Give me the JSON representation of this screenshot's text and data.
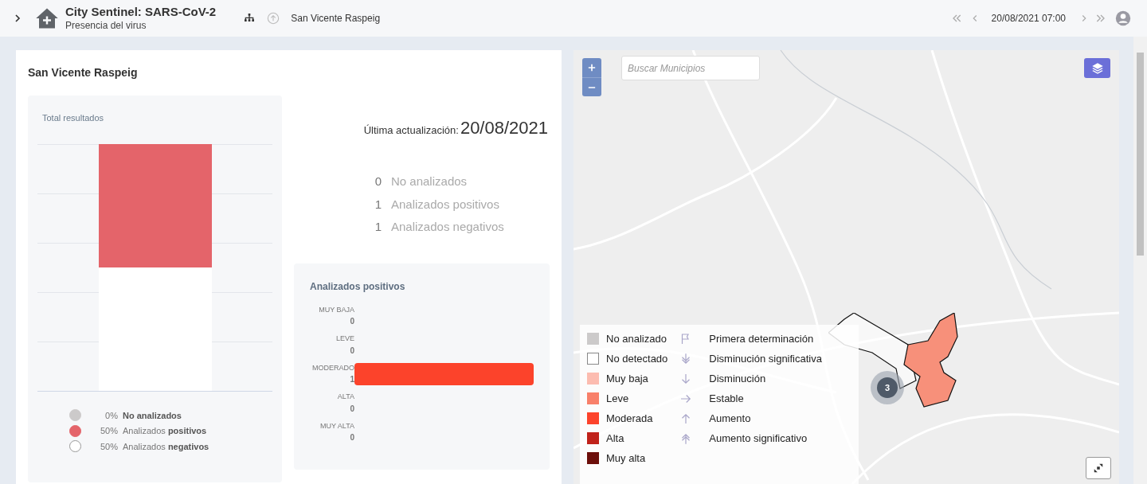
{
  "header": {
    "title": "City Sentinel: SARS-CoV-2",
    "subtitle": "Presencia del virus",
    "breadcrumb": "San Vicente Raspeig",
    "datetime": "20/08/2021 07:00"
  },
  "panel": {
    "title": "San Vicente Raspeig",
    "total": {
      "title": "Total resultados",
      "legend": [
        {
          "percent": "0%",
          "label": "**No analizados**",
          "color": "#cccaca",
          "level": 0
        },
        {
          "percent": "50%",
          "label": "Analizados **positivos**",
          "color": "#e4646a",
          "level": 0.5
        },
        {
          "percent": "50%",
          "label": "Analizados **negativos**",
          "color": "#ffffff",
          "level": 0.5
        }
      ]
    },
    "update": {
      "label": "Última actualización:",
      "date": "20/08/2021"
    },
    "counts": [
      {
        "value": "0",
        "label": "No analizados"
      },
      {
        "value": "1",
        "label": "Analizados positivos"
      },
      {
        "value": "1",
        "label": "Analizados negativos"
      }
    ],
    "positives": {
      "title": "Analizados positivos",
      "rows": [
        {
          "label": "MUY BAJA",
          "value": "0"
        },
        {
          "label": "LEVE",
          "value": "0"
        },
        {
          "label": "MODERADO",
          "value": "1"
        },
        {
          "label": "ALTA",
          "value": "0"
        },
        {
          "label": "MUY ALTA",
          "value": "0"
        }
      ]
    }
  },
  "map": {
    "search": {
      "placeholder": "Buscar Municipios"
    },
    "cluster": "3",
    "legend_levels": [
      {
        "label": "No analizado",
        "color": "#cccaca"
      },
      {
        "label": "No detectado",
        "color": "#ffffff"
      },
      {
        "label": "Muy baja",
        "color": "#fcbcb0"
      },
      {
        "label": "Leve",
        "color": "#f8806a"
      },
      {
        "label": "Moderada",
        "color": "#fc432b"
      },
      {
        "label": "Alta",
        "color": "#c0221a"
      },
      {
        "label": "Muy alta",
        "color": "#6c0e0a"
      }
    ],
    "legend_trends": [
      {
        "kind": "flag",
        "label": "Primera determinación"
      },
      {
        "kind": "double-down",
        "label": "Disminución significativa"
      },
      {
        "kind": "down",
        "label": "Disminución"
      },
      {
        "kind": "right",
        "label": "Estable"
      },
      {
        "kind": "up",
        "label": "Aumento"
      },
      {
        "kind": "double-up",
        "label": "Aumento significativo"
      }
    ]
  }
}
